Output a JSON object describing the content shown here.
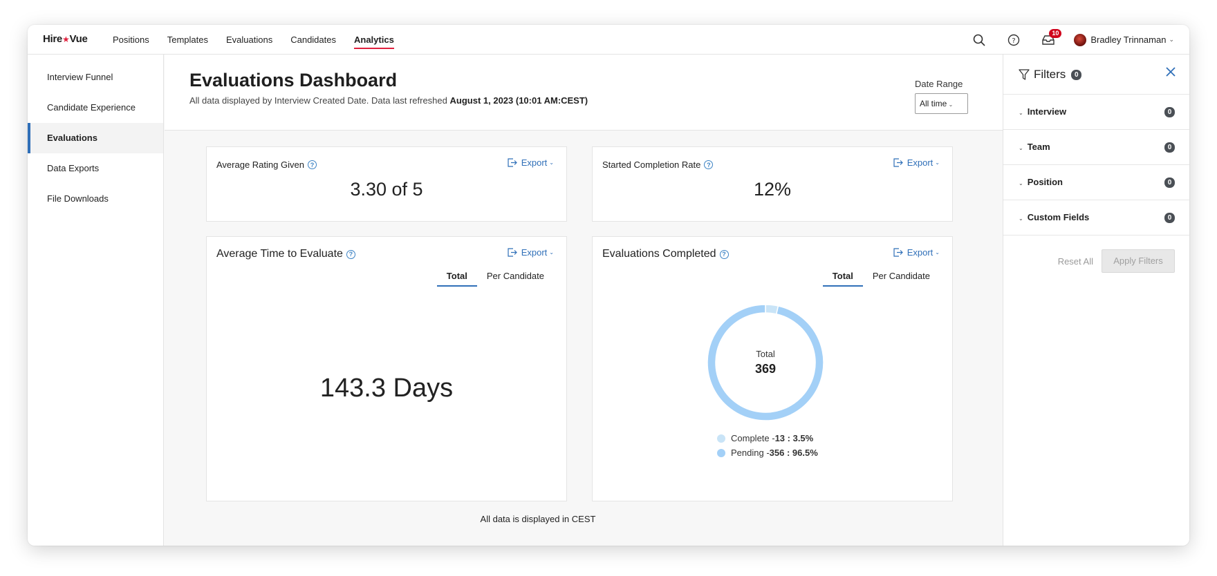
{
  "topbar": {
    "logo_prefix": "Hire",
    "logo_star": "★",
    "logo_suffix": "Vue",
    "nav": [
      {
        "label": "Positions"
      },
      {
        "label": "Templates"
      },
      {
        "label": "Evaluations"
      },
      {
        "label": "Candidates"
      },
      {
        "label": "Analytics",
        "active": true
      }
    ],
    "notifications_count": "10",
    "user_name": "Bradley Trinnaman",
    "icons": [
      "search-icon",
      "help-icon",
      "inbox-icon"
    ]
  },
  "sidebar": {
    "items": [
      {
        "label": "Interview Funnel"
      },
      {
        "label": "Candidate Experience"
      },
      {
        "label": "Evaluations",
        "active": true
      },
      {
        "label": "Data Exports"
      },
      {
        "label": "File Downloads"
      }
    ]
  },
  "header": {
    "title": "Evaluations Dashboard",
    "subtitle": "All data displayed by Interview Created Date. Data last refreshed",
    "refreshed": "August 1, 2023 (10:01 AM:CEST)",
    "date_range_label": "Date Range",
    "date_range_value": "All time"
  },
  "cards": {
    "export_label": "Export",
    "avg_rating": {
      "title": "Average Rating Given",
      "value": "3.30 of 5"
    },
    "completion_rate": {
      "title": "Started Completion Rate",
      "value": "12%"
    },
    "avg_time": {
      "title": "Average Time to Evaluate",
      "value": "143.3 Days",
      "tabs": [
        "Total",
        "Per Candidate"
      ]
    },
    "evaluations_completed": {
      "title": "Evaluations Completed",
      "tabs": [
        "Total",
        "Per Candidate"
      ],
      "center_label": "Total",
      "center_value": "369",
      "legend": [
        {
          "label": "Complete - ",
          "value": "13 : 3.5%",
          "color": "#c9e4f7"
        },
        {
          "label": "Pending - ",
          "value": "356 : 96.5%",
          "color": "#a3d0f7"
        }
      ]
    }
  },
  "chart_data": {
    "type": "pie",
    "title": "Evaluations Completed",
    "categories": [
      "Complete",
      "Pending"
    ],
    "values": [
      13,
      356
    ],
    "percentages": [
      3.5,
      96.5
    ],
    "total": 369,
    "colors": [
      "#c9e4f7",
      "#a3d0f7"
    ]
  },
  "footnote": "All data is displayed in CEST",
  "filters": {
    "title": "Filters",
    "count": "0",
    "rows": [
      {
        "label": "Interview",
        "count": "0"
      },
      {
        "label": "Team",
        "count": "0"
      },
      {
        "label": "Position",
        "count": "0"
      },
      {
        "label": "Custom Fields",
        "count": "0"
      }
    ],
    "reset_label": "Reset All",
    "apply_label": "Apply Filters"
  }
}
